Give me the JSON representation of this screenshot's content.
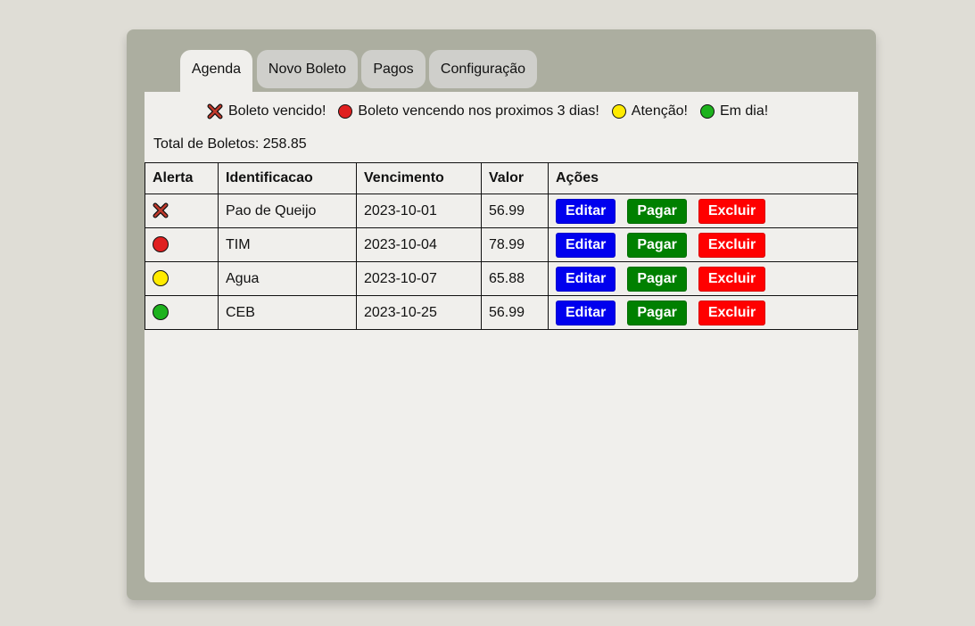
{
  "tabs": [
    {
      "label": "Agenda",
      "active": true
    },
    {
      "label": "Novo Boleto",
      "active": false
    },
    {
      "label": "Pagos",
      "active": false
    },
    {
      "label": "Configuração",
      "active": false
    }
  ],
  "legend": [
    {
      "icon": "x-icon",
      "color": "#c0392b",
      "label": "Boleto vencido!"
    },
    {
      "icon": "red-dot-icon",
      "color": "#e02020",
      "label": "Boleto vencendo nos proximos 3 dias!"
    },
    {
      "icon": "yellow-dot-icon",
      "color": "#ffeb00",
      "label": "Atenção!"
    },
    {
      "icon": "green-dot-icon",
      "color": "#1db21d",
      "label": "Em dia!"
    }
  ],
  "total": "Total de Boletos: 258.85",
  "table": {
    "headers": [
      "Alerta",
      "Identificacao",
      "Vencimento",
      "Valor",
      "Ações"
    ],
    "rows": [
      {
        "alert": "x-icon",
        "alert_color": "#c0392b",
        "id": "Pao de Queijo",
        "due": "2023-10-01",
        "value": "56.99"
      },
      {
        "alert": "red-dot-icon",
        "alert_color": "#e02020",
        "id": "TIM",
        "due": "2023-10-04",
        "value": "78.99"
      },
      {
        "alert": "yellow-dot-icon",
        "alert_color": "#ffeb00",
        "id": "Agua",
        "due": "2023-10-07",
        "value": "65.88"
      },
      {
        "alert": "green-dot-icon",
        "alert_color": "#1db21d",
        "id": "CEB",
        "due": "2023-10-25",
        "value": "56.99"
      }
    ],
    "actions": {
      "edit": "Editar",
      "pay": "Pagar",
      "delete": "Excluir"
    }
  }
}
